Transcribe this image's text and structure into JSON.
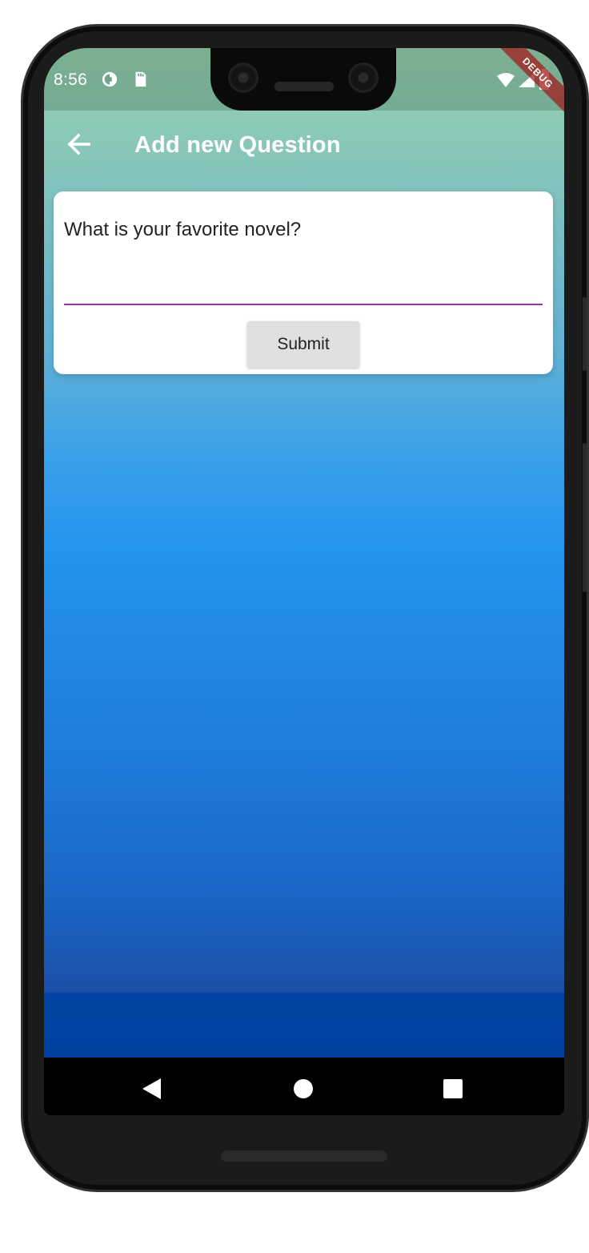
{
  "status_bar": {
    "time": "8:56",
    "icons": [
      "data-saver-icon",
      "sd-card-icon",
      "wifi-icon",
      "signal-icon",
      "battery-icon"
    ]
  },
  "debug_banner": "DEBUG",
  "app_bar": {
    "title": "Add new Question",
    "back_icon": "arrow-back-icon"
  },
  "form": {
    "question_value": "What is your favorite novel?",
    "submit_label": "Submit",
    "underline_color": "#9b35a8"
  },
  "nav_bar": {
    "buttons": [
      "back-triangle-icon",
      "home-circle-icon",
      "recents-square-icon"
    ]
  },
  "colors": {
    "gradient_top": "#98d0ac",
    "gradient_bottom": "#0041a0",
    "title_text": "#ffffff"
  }
}
